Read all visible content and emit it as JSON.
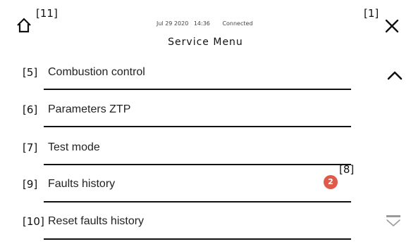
{
  "header": {
    "title": "Service Menu",
    "date": "Jul 29 2020",
    "time": "14:36",
    "connection": "Connected",
    "home_marker": "[11]",
    "close_marker": "[1]",
    "home_icon": "home-icon",
    "close_icon": "close-icon"
  },
  "menu": {
    "items": [
      {
        "index": "[5]",
        "label": "Combustion control"
      },
      {
        "index": "[6]",
        "label": "Parameters ZTP"
      },
      {
        "index": "[7]",
        "label": "Test mode"
      },
      {
        "index": "[9]",
        "label": "Faults history",
        "badge": "2",
        "badge_marker": "[8]"
      },
      {
        "index": "[10]",
        "label": "Reset faults history"
      }
    ]
  },
  "scroll": {
    "up_icon": "chevron-up-icon",
    "down_icon": "chevron-down-icon"
  },
  "colors": {
    "badge": "#e05a4a",
    "text": "#1a1a1a",
    "divider": "#111111"
  }
}
